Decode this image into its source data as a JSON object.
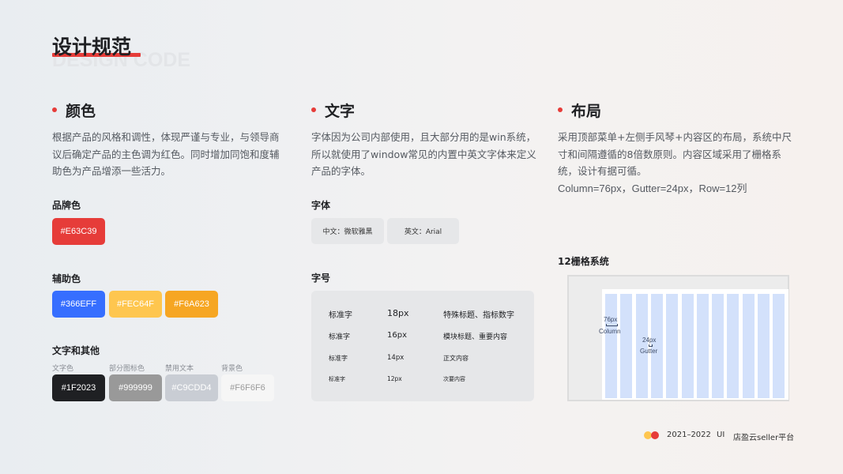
{
  "header": {
    "title": "设计规范",
    "subtitle_en": "DESIGN CODE"
  },
  "color": {
    "title": "颜色",
    "desc": "根据产品的风格和调性，体现严谨与专业，与领导商议后确定产品的主色调为红色。同时增加同饱和度辅助色为产品增添一些活力。",
    "brand_title": "品牌色",
    "brand": [
      {
        "hex": "#E63C39"
      }
    ],
    "aux_title": "辅助色",
    "aux": [
      {
        "hex": "#366EFF"
      },
      {
        "hex": "#FEC64F"
      },
      {
        "hex": "#F6A623"
      }
    ],
    "text_title": "文字和其他",
    "text_colors": [
      {
        "label": "文字色",
        "hex": "#1F2023"
      },
      {
        "label": "部分图标色",
        "hex": "#999999"
      },
      {
        "label": "禁用文本",
        "hex": "#C9CDD4"
      },
      {
        "label": "背景色",
        "hex": "#F6F6F6"
      }
    ]
  },
  "typography": {
    "title": "文字",
    "desc": "字体因为公司内部使用，且大部分用的是win系统，所以就使用了window常见的内置中英文字体来定义产品的字体。",
    "font_title": "字体",
    "fonts": [
      "中文：微软雅黑",
      "英文：Arial"
    ],
    "size_title": "字号",
    "sizes": [
      {
        "name": "标准字",
        "size": "18px",
        "usage": "特殊标题、指标数字"
      },
      {
        "name": "标准字",
        "size": "16px",
        "usage": "模块标题、重要内容"
      },
      {
        "name": "标准字",
        "size": "14px",
        "usage": "正文内容"
      },
      {
        "name": "标准字",
        "size": "12px",
        "usage": "次要内容"
      }
    ]
  },
  "layout": {
    "title": "布局",
    "desc": "采用顶部菜单+左侧手风琴+内容区的布局，系统中尺寸和间隔遵循的8倍数原则。内容区域采用了栅格系统，设计有据可循。",
    "spec": "Column=76px，Gutter=24px，Row=12列",
    "grid_title": "12栅格系统",
    "grid_columns": 12,
    "column_label": "76px",
    "column_caption": "Column",
    "gutter_label": "24px",
    "gutter_caption": "Gutter"
  },
  "footer": {
    "year": "2021–2022",
    "tag": "UI",
    "platform": "店盈云seller平台",
    "dot_colors": [
      "#FEC64F",
      "#E63C39"
    ]
  }
}
